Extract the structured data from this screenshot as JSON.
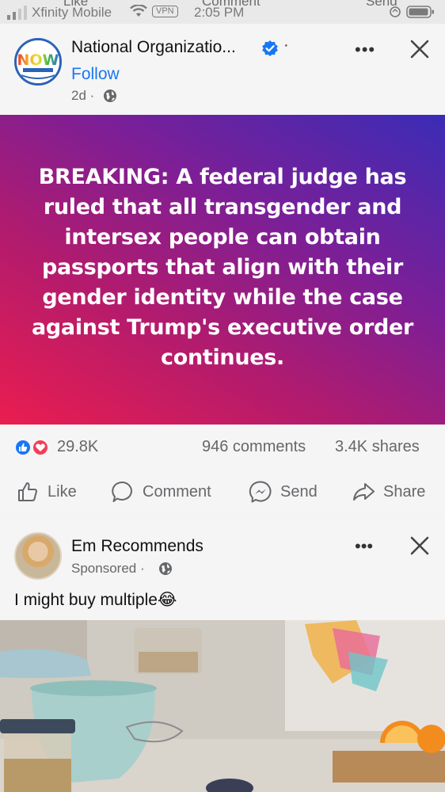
{
  "status_bar": {
    "carrier": "Xfinity Mobile",
    "vpn": "VPN",
    "time": "2:05 PM",
    "ghost_labels": [
      "Like",
      "Comment",
      "Send"
    ]
  },
  "post": {
    "page_name": "National Organizatio...",
    "dot": "·",
    "follow_label": "Follow",
    "time": "2d ·",
    "more": "•••",
    "breaking_text": "BREAKING: A federal judge has ruled that all transgender and intersex people can obtain passports that align with their gender identity while the case against Trump's executive order continues.",
    "reactions_count": "29.8K",
    "comments": "946 comments",
    "shares": "3.4K shares",
    "actions": {
      "like": "Like",
      "comment": "Comment",
      "send": "Send",
      "share": "Share"
    },
    "colors": {
      "accent": "#1877f2",
      "gradient_start": "#ea1d4f",
      "gradient_end": "#3a2cb6"
    }
  },
  "sponsored": {
    "name": "Em Recommends",
    "label": "Sponsored ·",
    "more": "•••",
    "caption": "I might buy multiple😂"
  }
}
